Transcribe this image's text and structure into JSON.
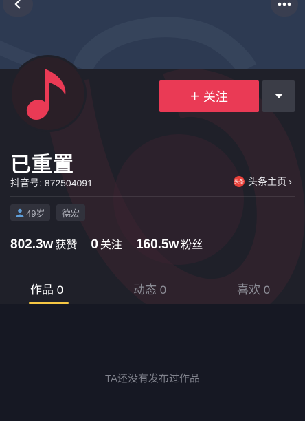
{
  "header": {
    "back_icon": "chevron-left-icon",
    "more_icon": "more-dots-icon"
  },
  "profile": {
    "avatar_icon": "music-note-icon",
    "name": "已重置",
    "douyin_id": "抖音号: 872504091",
    "toutiao_badge": "头条",
    "toutiao_label": "头条主页",
    "follow_plus": "+",
    "follow_label": "关注",
    "tags": {
      "age": "49岁",
      "location": "德宏"
    },
    "stats": {
      "likes_num": "802.3w",
      "likes_label": "获赞",
      "following_num": "0",
      "following_label": "关注",
      "fans_num": "160.5w",
      "fans_label": "粉丝"
    }
  },
  "tabs": {
    "works": "作品 0",
    "dynamic": "动态 0",
    "likes": "喜欢 0"
  },
  "content": {
    "empty_text": "TA还没有发布过作品"
  },
  "colors": {
    "accent": "#ea3a55",
    "tab_indicator": "#f6c744",
    "background": "#161823"
  }
}
